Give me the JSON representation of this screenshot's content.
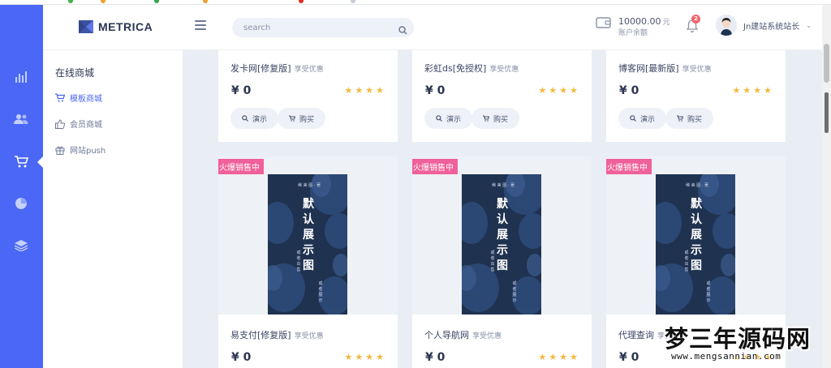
{
  "header": {
    "brand": "METRICA",
    "search_placeholder": "search",
    "balance": "10000.00",
    "balance_unit": "元",
    "balance_label": "账户余额",
    "notification_count": "2",
    "username": "Jn建站系统站长"
  },
  "subnav": {
    "title": "在线商城",
    "items": [
      {
        "label": "模板商城",
        "icon": "cart-icon",
        "active": true
      },
      {
        "label": "会员商城",
        "icon": "thumbs-up-icon",
        "active": false
      },
      {
        "label": "网站push",
        "icon": "gift-icon",
        "active": false
      }
    ]
  },
  "rail": {
    "icons": [
      "bar-chart-icon",
      "users-icon",
      "cart-icon",
      "pie-chart-icon",
      "layers-icon"
    ],
    "active_index": 2
  },
  "products_row1": [
    {
      "name": "发卡网[修复版]",
      "perk": "享受优惠",
      "price": "¥ 0",
      "stars": "★★★★"
    },
    {
      "name": "彩虹ds[免授权]",
      "perk": "享受优惠",
      "price": "¥ 0",
      "stars": "★★★★"
    },
    {
      "name": "博客网[最新版]",
      "perk": "享受优惠",
      "price": "¥ 0",
      "stars": "★★★★"
    }
  ],
  "products_row2": [
    {
      "name": "易支付[修复版]",
      "perk": "享受优惠",
      "price": "¥ 0",
      "stars": "★★★★",
      "badge": "火爆销售中"
    },
    {
      "name": "个人导航网",
      "perk": "享受优惠",
      "price": "¥ 0",
      "stars": "★★★★",
      "badge": "火爆销售中"
    },
    {
      "name": "代理查询",
      "perk": "享受优惠",
      "price": "¥ 0",
      "stars": "★★★★",
      "badge": "火爆销售中"
    }
  ],
  "buttons": {
    "demo": "演示",
    "buy": "购买"
  },
  "book_cover": {
    "title": "默认展示图",
    "author_line": "稀 美 图 · 著",
    "sub_left": "或者出售",
    "sub_right": "或者展示"
  },
  "watermark": {
    "text": "梦三年源码网",
    "url": "www.mengsannian.com"
  },
  "colors": {
    "primary": "#4a67f5",
    "hot_badge": "#f0609a",
    "star": "#f5b83d",
    "book": "#1f3250",
    "badge_red": "#f1646c"
  }
}
